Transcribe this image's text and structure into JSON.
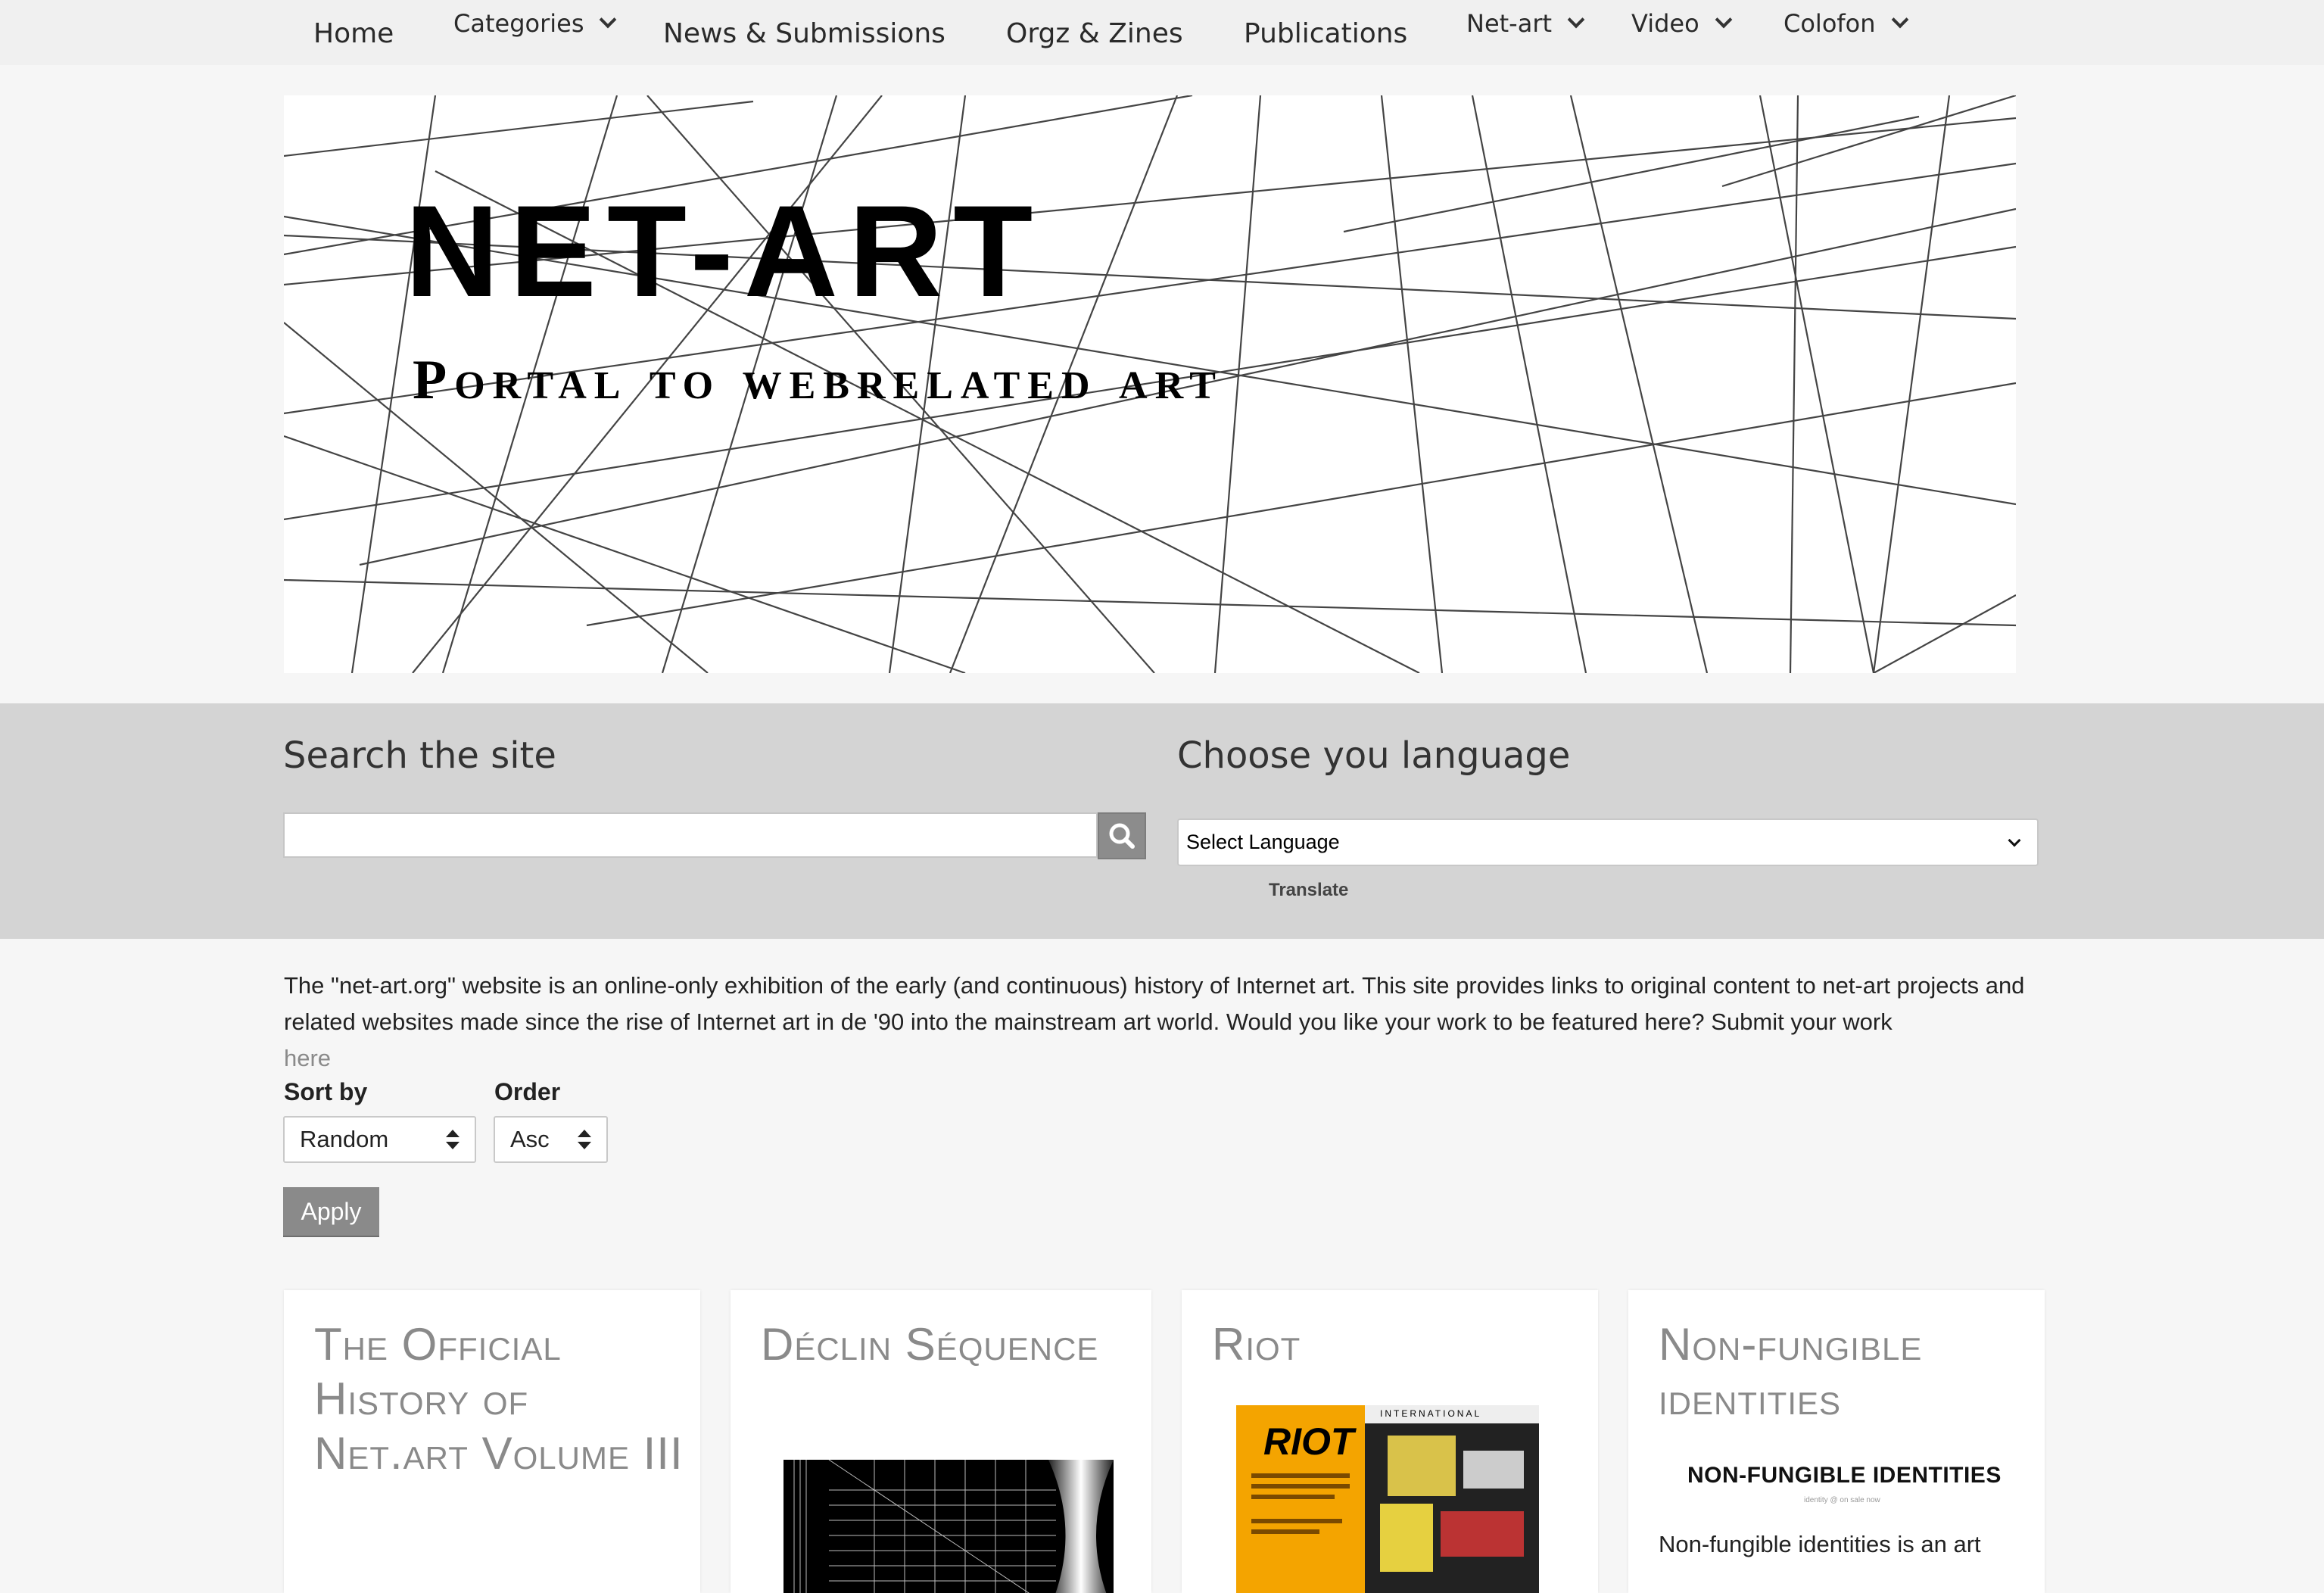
{
  "nav": {
    "home": "Home",
    "categories": "Categories",
    "news": "News & Submissions",
    "orgz": "Orgz & Zines",
    "publications": "Publications",
    "netart": "Net-art",
    "video": "Video",
    "colofon": "Colofon"
  },
  "banner": {
    "title": "NET-ART",
    "subtitle": "Portal to webrelated art"
  },
  "search": {
    "title": "Search the site",
    "placeholder": ""
  },
  "language": {
    "title": "Choose you language",
    "selected": "Select Language",
    "translate": "Translate"
  },
  "intro": {
    "text": "The \"net-art.org\" website is an online-only exhibition of the early (and continuous) history of Internet art. This site provides links to original content to net-art projects and related websites made since the rise of Internet art in de '90 into the mainstream art world. Would you like your work to be featured here? Submit your work",
    "link": "here"
  },
  "sort": {
    "sort_label": "Sort by",
    "sort_value": "Random",
    "order_label": "Order",
    "order_value": "Asc",
    "apply": "Apply"
  },
  "cards": [
    {
      "title": "The Official History of Net.art Volume III"
    },
    {
      "title": "Déclin Séquence"
    },
    {
      "title": "Riot",
      "thumb_text": "RIOT",
      "thumb_banner": "INTERNATIONAL"
    },
    {
      "title": "Non-fungible identities",
      "thumb_heading": "NON-FUNGIBLE IDENTITIES",
      "thumb_sub": "identity @ on sale now",
      "desc": "Non-fungible identities is an art"
    }
  ],
  "colors": {
    "nav_bg": "#f0f0f0",
    "band_bg": "#d4d4d4",
    "accent_grey": "#8a8a8a",
    "riot_orange": "#f4a400"
  },
  "icons": {
    "search": "search-icon",
    "chevron": "chevron-down-icon"
  }
}
